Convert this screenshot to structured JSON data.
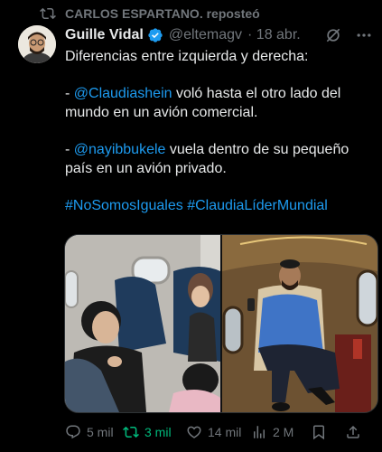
{
  "repost": {
    "text": "CARLOS ESPARTANO. reposteó",
    "icon": "repost-icon"
  },
  "author": {
    "name": "Guille Vidal",
    "handle": "@eltemagv",
    "date": "· 18 abr.",
    "verified": true
  },
  "post": {
    "line1": "Diferencias entre izquierda y derecha:",
    "p2_prefix": "- ",
    "p2_mention": "@Claudiashein",
    "p2_rest": " voló hasta el otro lado del mundo en un avión comercial.",
    "p3_prefix": "- ",
    "p3_mention": "@nayibbukele",
    "p3_rest": " vuela dentro de su pequeño país en un avión privado.",
    "hashtag1": "#NoSomosIguales",
    "hashtag2": "#ClaudiaLíderMundial"
  },
  "actions": {
    "replies": "5 mil",
    "reposts": "3 mil",
    "likes": "14 mil",
    "views": "2 M"
  },
  "colors": {
    "background": "#000000",
    "link": "#1d9bf0",
    "muted": "#71767b",
    "repost_active": "#00ba7c"
  }
}
